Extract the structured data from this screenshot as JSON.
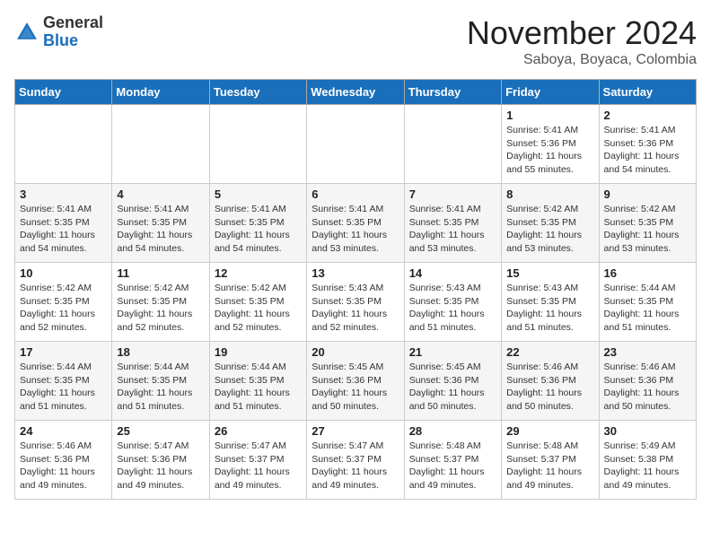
{
  "header": {
    "logo_general": "General",
    "logo_blue": "Blue",
    "month_title": "November 2024",
    "location": "Saboya, Boyaca, Colombia"
  },
  "days_of_week": [
    "Sunday",
    "Monday",
    "Tuesday",
    "Wednesday",
    "Thursday",
    "Friday",
    "Saturday"
  ],
  "weeks": [
    [
      {
        "day": null
      },
      {
        "day": null
      },
      {
        "day": null
      },
      {
        "day": null
      },
      {
        "day": null
      },
      {
        "day": "1",
        "sunrise": "5:41 AM",
        "sunset": "5:36 PM",
        "daylight": "11 hours and 55 minutes."
      },
      {
        "day": "2",
        "sunrise": "5:41 AM",
        "sunset": "5:36 PM",
        "daylight": "11 hours and 54 minutes."
      }
    ],
    [
      {
        "day": "3",
        "sunrise": "5:41 AM",
        "sunset": "5:35 PM",
        "daylight": "11 hours and 54 minutes."
      },
      {
        "day": "4",
        "sunrise": "5:41 AM",
        "sunset": "5:35 PM",
        "daylight": "11 hours and 54 minutes."
      },
      {
        "day": "5",
        "sunrise": "5:41 AM",
        "sunset": "5:35 PM",
        "daylight": "11 hours and 54 minutes."
      },
      {
        "day": "6",
        "sunrise": "5:41 AM",
        "sunset": "5:35 PM",
        "daylight": "11 hours and 53 minutes."
      },
      {
        "day": "7",
        "sunrise": "5:41 AM",
        "sunset": "5:35 PM",
        "daylight": "11 hours and 53 minutes."
      },
      {
        "day": "8",
        "sunrise": "5:42 AM",
        "sunset": "5:35 PM",
        "daylight": "11 hours and 53 minutes."
      },
      {
        "day": "9",
        "sunrise": "5:42 AM",
        "sunset": "5:35 PM",
        "daylight": "11 hours and 53 minutes."
      }
    ],
    [
      {
        "day": "10",
        "sunrise": "5:42 AM",
        "sunset": "5:35 PM",
        "daylight": "11 hours and 52 minutes."
      },
      {
        "day": "11",
        "sunrise": "5:42 AM",
        "sunset": "5:35 PM",
        "daylight": "11 hours and 52 minutes."
      },
      {
        "day": "12",
        "sunrise": "5:42 AM",
        "sunset": "5:35 PM",
        "daylight": "11 hours and 52 minutes."
      },
      {
        "day": "13",
        "sunrise": "5:43 AM",
        "sunset": "5:35 PM",
        "daylight": "11 hours and 52 minutes."
      },
      {
        "day": "14",
        "sunrise": "5:43 AM",
        "sunset": "5:35 PM",
        "daylight": "11 hours and 51 minutes."
      },
      {
        "day": "15",
        "sunrise": "5:43 AM",
        "sunset": "5:35 PM",
        "daylight": "11 hours and 51 minutes."
      },
      {
        "day": "16",
        "sunrise": "5:44 AM",
        "sunset": "5:35 PM",
        "daylight": "11 hours and 51 minutes."
      }
    ],
    [
      {
        "day": "17",
        "sunrise": "5:44 AM",
        "sunset": "5:35 PM",
        "daylight": "11 hours and 51 minutes."
      },
      {
        "day": "18",
        "sunrise": "5:44 AM",
        "sunset": "5:35 PM",
        "daylight": "11 hours and 51 minutes."
      },
      {
        "day": "19",
        "sunrise": "5:44 AM",
        "sunset": "5:35 PM",
        "daylight": "11 hours and 51 minutes."
      },
      {
        "day": "20",
        "sunrise": "5:45 AM",
        "sunset": "5:36 PM",
        "daylight": "11 hours and 50 minutes."
      },
      {
        "day": "21",
        "sunrise": "5:45 AM",
        "sunset": "5:36 PM",
        "daylight": "11 hours and 50 minutes."
      },
      {
        "day": "22",
        "sunrise": "5:46 AM",
        "sunset": "5:36 PM",
        "daylight": "11 hours and 50 minutes."
      },
      {
        "day": "23",
        "sunrise": "5:46 AM",
        "sunset": "5:36 PM",
        "daylight": "11 hours and 50 minutes."
      }
    ],
    [
      {
        "day": "24",
        "sunrise": "5:46 AM",
        "sunset": "5:36 PM",
        "daylight": "11 hours and 49 minutes."
      },
      {
        "day": "25",
        "sunrise": "5:47 AM",
        "sunset": "5:36 PM",
        "daylight": "11 hours and 49 minutes."
      },
      {
        "day": "26",
        "sunrise": "5:47 AM",
        "sunset": "5:37 PM",
        "daylight": "11 hours and 49 minutes."
      },
      {
        "day": "27",
        "sunrise": "5:47 AM",
        "sunset": "5:37 PM",
        "daylight": "11 hours and 49 minutes."
      },
      {
        "day": "28",
        "sunrise": "5:48 AM",
        "sunset": "5:37 PM",
        "daylight": "11 hours and 49 minutes."
      },
      {
        "day": "29",
        "sunrise": "5:48 AM",
        "sunset": "5:37 PM",
        "daylight": "11 hours and 49 minutes."
      },
      {
        "day": "30",
        "sunrise": "5:49 AM",
        "sunset": "5:38 PM",
        "daylight": "11 hours and 49 minutes."
      }
    ]
  ],
  "labels": {
    "sunrise": "Sunrise:",
    "sunset": "Sunset:",
    "daylight": "Daylight:"
  }
}
